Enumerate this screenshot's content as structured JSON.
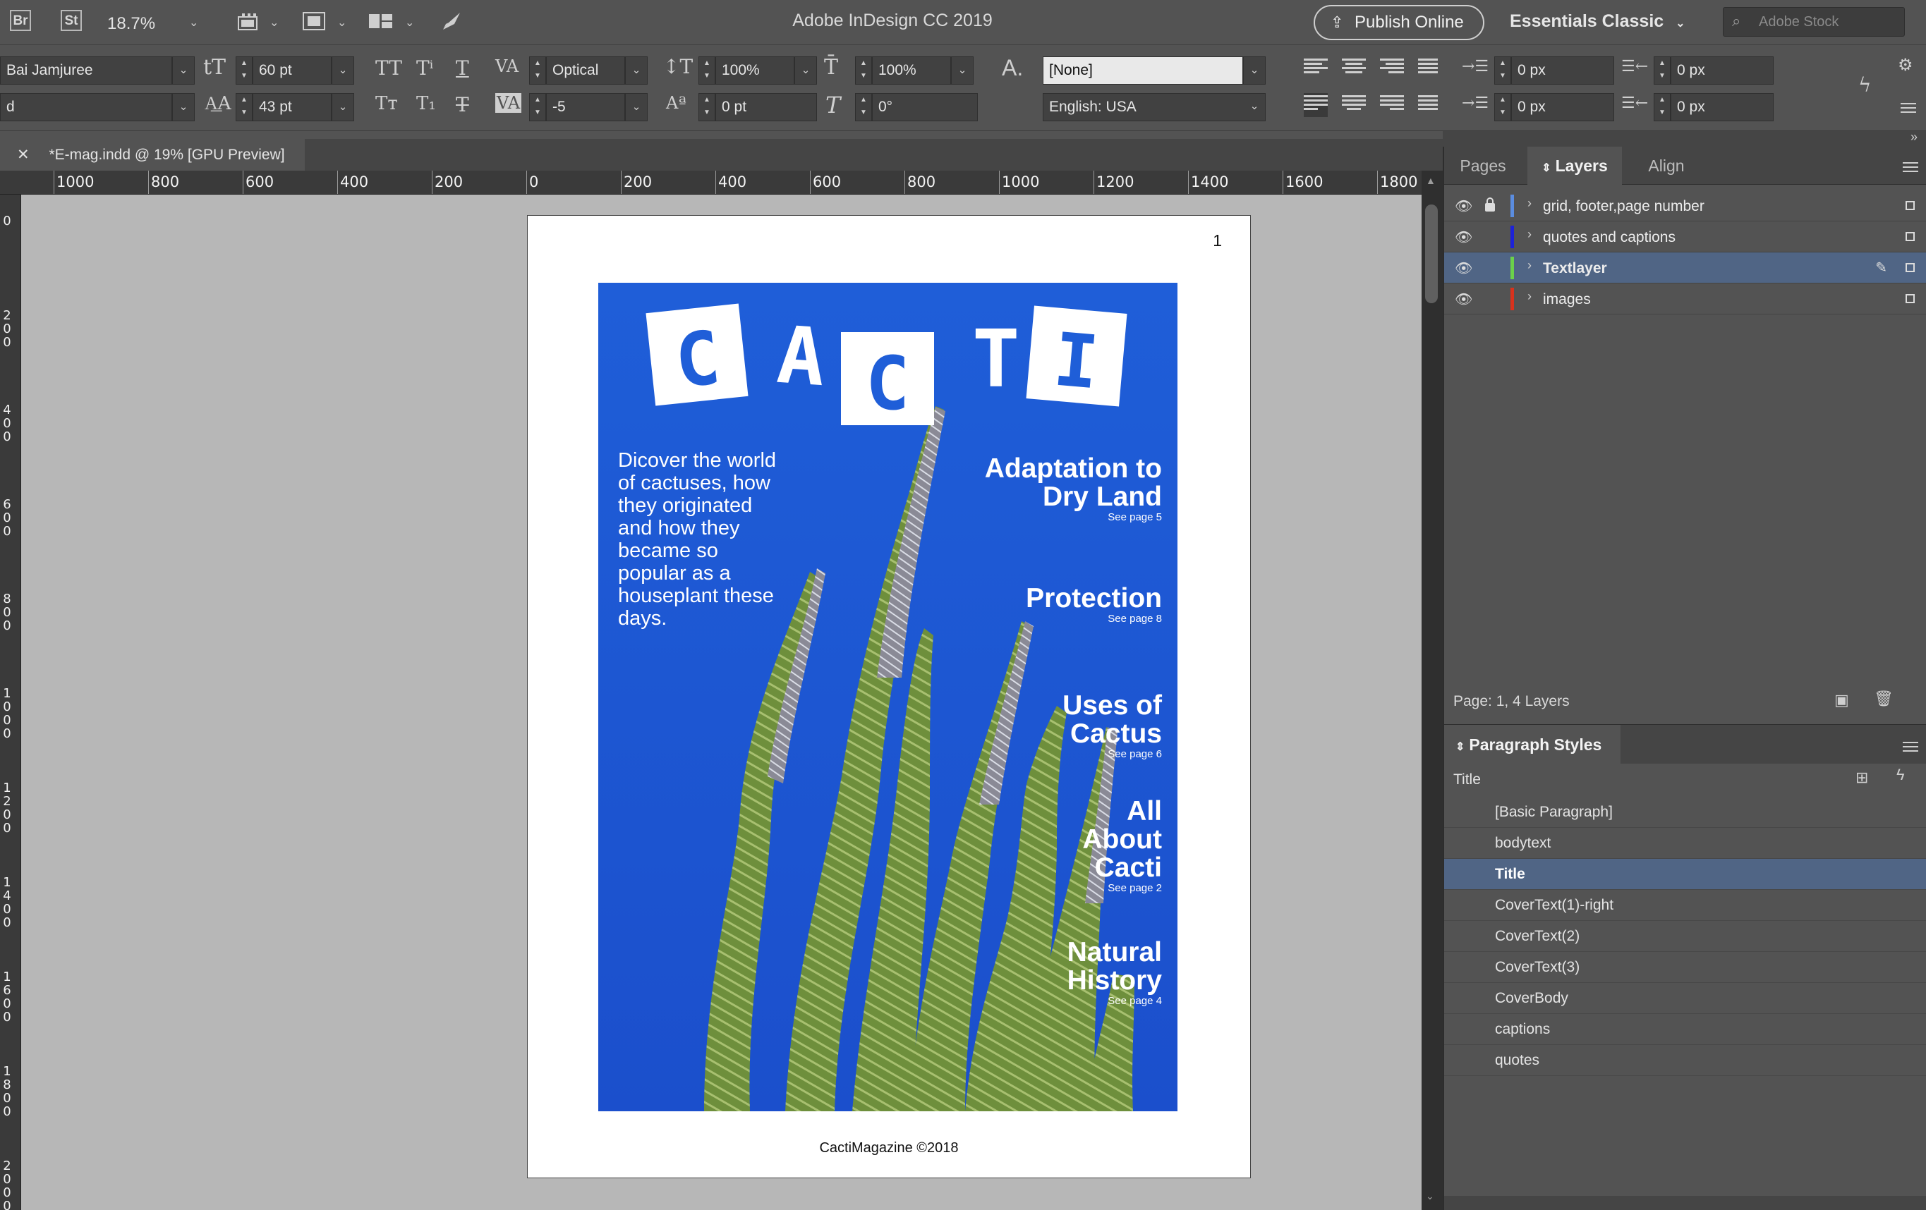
{
  "app": {
    "badges": [
      "Br",
      "St"
    ],
    "zoom": "18.7%",
    "title": "Adobe InDesign CC 2019",
    "publish_label": "Publish Online",
    "workspace": "Essentials Classic",
    "stock_placeholder": "Adobe Stock"
  },
  "control": {
    "font_family": "Bai Jamjuree",
    "font_style": "d",
    "font_size": "60 pt",
    "leading": "43 pt",
    "kerning": "Optical",
    "tracking": "-5",
    "vertical_scale": "100%",
    "horizontal_scale": "100%",
    "baseline_shift": "0 pt",
    "skew": "0°",
    "char_style": "[None]",
    "language": "English: USA",
    "left_indent": "0 px",
    "right_indent": "0 px",
    "first_line_indent": "0 px",
    "last_line_indent": "0 px"
  },
  "document": {
    "tab_label": "*E-mag.indd @ 19% [GPU Preview]",
    "close_glyph": "✕"
  },
  "rulers": {
    "h_labels": [
      "1000",
      "800",
      "600",
      "400",
      "200",
      "0",
      "200",
      "400",
      "600",
      "800",
      "1000",
      "1200",
      "1400",
      "1600",
      "1800"
    ],
    "v_labels": [
      "0",
      "200",
      "400",
      "600",
      "800",
      "1000",
      "1200",
      "1400",
      "1600",
      "1800",
      "2000"
    ]
  },
  "page": {
    "page_number": "1",
    "footer": "CactiMagazine ©2018",
    "logo_letters": [
      "C",
      "A",
      "C",
      "T",
      "I"
    ],
    "cover_body": "Dicover the world of cactuses, how they originated and how they became so popular as a houseplant these days.",
    "stories": [
      {
        "title": "Adaptation to Dry Land",
        "page_ref": "See page 5"
      },
      {
        "title": "Protection",
        "page_ref": "See page 8"
      },
      {
        "title": "Uses of Cactus",
        "page_ref": "See page 6"
      },
      {
        "title": "All About Cacti",
        "page_ref": "See page 2"
      },
      {
        "title": "Natural History",
        "page_ref": "See page 4"
      }
    ]
  },
  "panels": {
    "tabs": [
      "Pages",
      "Layers",
      "Align"
    ],
    "active_tab": "Layers",
    "layers": [
      {
        "name": "grid, footer,page number",
        "color": "#5b8de0",
        "locked": true,
        "selected": false
      },
      {
        "name": "quotes and captions",
        "color": "#1d22d8",
        "locked": false,
        "selected": false
      },
      {
        "name": "Textlayer",
        "color": "#6bd14a",
        "locked": false,
        "selected": true
      },
      {
        "name": "images",
        "color": "#d8321d",
        "locked": false,
        "selected": false
      }
    ],
    "layers_status": "Page: 1, 4 Layers",
    "paragraph_styles": {
      "tab_label": "Paragraph Styles",
      "current": "Title",
      "items": [
        "[Basic Paragraph]",
        "bodytext",
        "Title",
        "CoverText(1)-right",
        "CoverText(2)",
        "CoverText(3)",
        "CoverBody",
        "captions",
        "quotes"
      ],
      "selected": "Title"
    }
  }
}
